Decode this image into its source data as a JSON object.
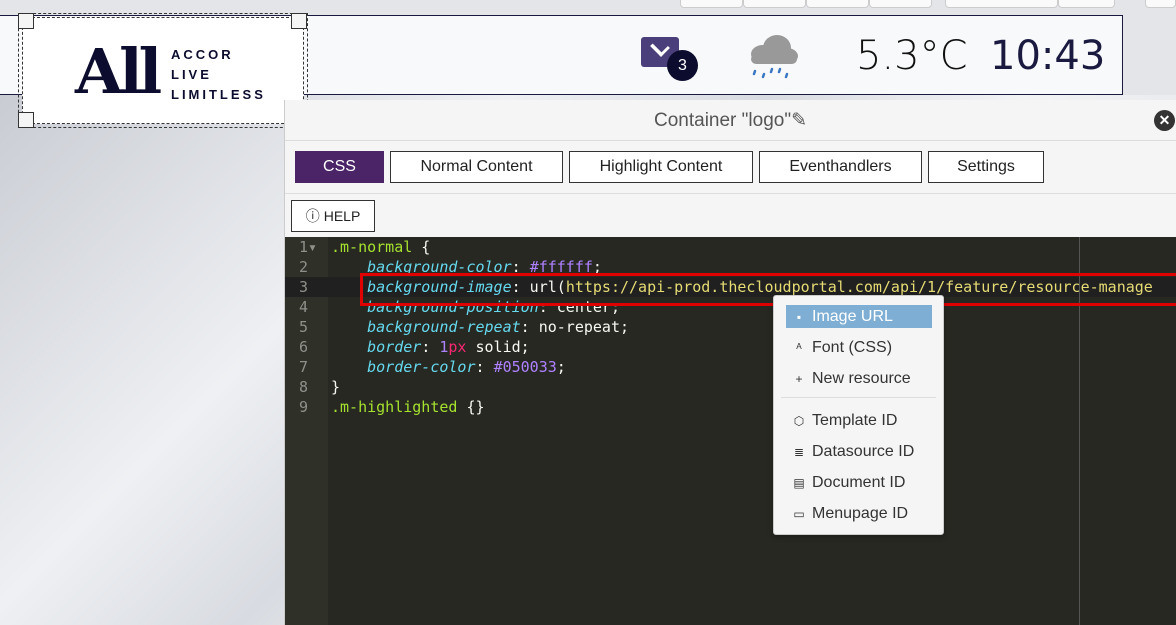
{
  "banner": {
    "logo_words": [
      "ACCOR",
      "LIVE",
      "LIMITLESS"
    ],
    "logo_mark": "All",
    "mail_count": "3",
    "weather_icon": "rain-cloud-icon",
    "temperature": "5.3°C",
    "time": "10:43"
  },
  "dialog": {
    "title": "Container \"logo\"",
    "tabs": [
      "CSS",
      "Normal Content",
      "Highlight Content",
      "Eventhandlers",
      "Settings"
    ],
    "active_tab": "CSS",
    "help_label": "HELP"
  },
  "editor": {
    "lines": [
      [
        {
          "t": ".m-normal",
          "c": "k"
        },
        {
          "t": " {",
          "c": ""
        }
      ],
      [
        {
          "t": "    ",
          "c": ""
        },
        {
          "t": "background-color",
          "c": "p"
        },
        {
          "t": ": ",
          "c": ""
        },
        {
          "t": "#ffffff",
          "c": "v"
        },
        {
          "t": ";",
          "c": ""
        }
      ],
      [
        {
          "t": "    ",
          "c": ""
        },
        {
          "t": "background-image",
          "c": "p"
        },
        {
          "t": ": url(",
          "c": ""
        },
        {
          "t": "https://api-prod.thecloudportal.com/api/1/feature/resource-manage",
          "c": "s"
        }
      ],
      [
        {
          "t": "    ",
          "c": ""
        },
        {
          "t": "background-position",
          "c": "p"
        },
        {
          "t": ": center;",
          "c": ""
        }
      ],
      [
        {
          "t": "    ",
          "c": ""
        },
        {
          "t": "background-repeat",
          "c": "p"
        },
        {
          "t": ": no-repeat;",
          "c": ""
        }
      ],
      [
        {
          "t": "    ",
          "c": ""
        },
        {
          "t": "border",
          "c": "p"
        },
        {
          "t": ": ",
          "c": ""
        },
        {
          "t": "1",
          "c": "v"
        },
        {
          "t": "px",
          "c": "n"
        },
        {
          "t": " solid;",
          "c": ""
        }
      ],
      [
        {
          "t": "    ",
          "c": ""
        },
        {
          "t": "border-color",
          "c": "p"
        },
        {
          "t": ": ",
          "c": ""
        },
        {
          "t": "#050033",
          "c": "v"
        },
        {
          "t": ";",
          "c": ""
        }
      ],
      [
        {
          "t": "}",
          "c": ""
        }
      ],
      [
        {
          "t": ".m-highlighted",
          "c": "k"
        },
        {
          "t": " {}",
          "c": ""
        }
      ]
    ]
  },
  "menu": {
    "items": [
      {
        "label": "Image URL",
        "icon": "image-icon",
        "glyph": "▪"
      },
      {
        "label": "Font (CSS)",
        "icon": "font-icon",
        "glyph": "ᴬ"
      },
      {
        "label": "New resource",
        "icon": "plus-icon",
        "glyph": "+"
      },
      {
        "label": "Template ID",
        "icon": "cube-icon",
        "glyph": "⬡"
      },
      {
        "label": "Datasource ID",
        "icon": "database-icon",
        "glyph": "≣"
      },
      {
        "label": "Document ID",
        "icon": "document-icon",
        "glyph": "▤"
      },
      {
        "label": "Menupage ID",
        "icon": "tv-icon",
        "glyph": "▭"
      }
    ],
    "selected": "Image URL"
  }
}
